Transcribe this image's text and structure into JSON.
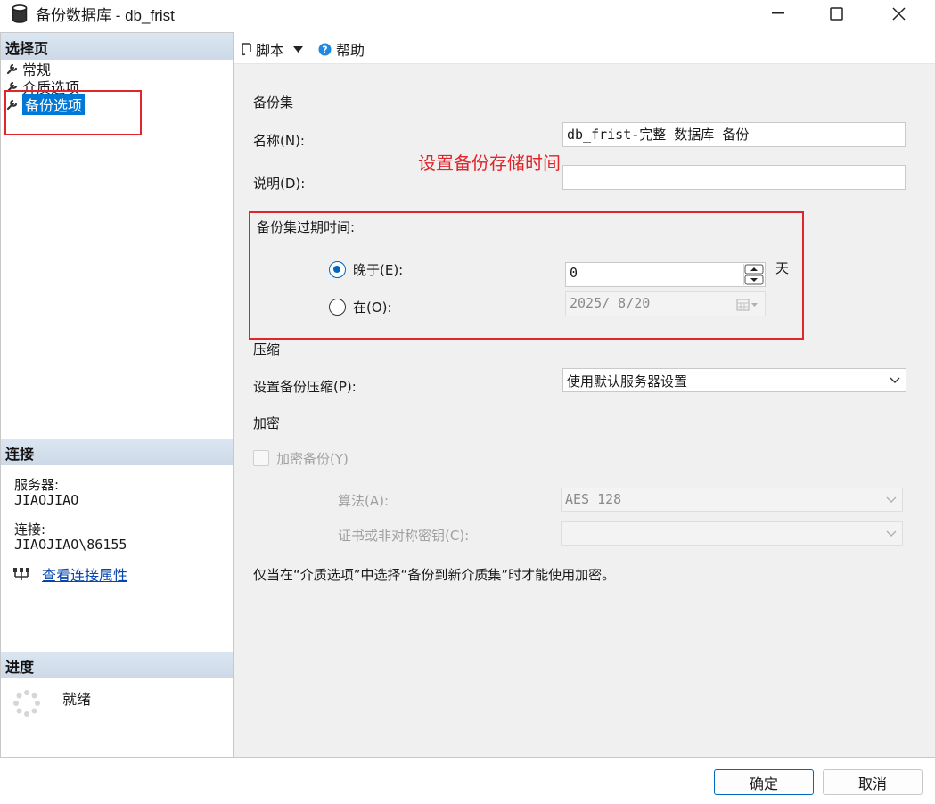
{
  "window": {
    "title": "备份数据库 - db_frist"
  },
  "left": {
    "select_page_header": "选择页",
    "nav_items": [
      {
        "label": "常规"
      },
      {
        "label": "介质选项"
      },
      {
        "label": "备份选项"
      }
    ],
    "connection": {
      "header": "连接",
      "server_label": "服务器:",
      "server_value": "JIAOJIAO",
      "conn_label": "连接:",
      "conn_value": "JIAOJIAO\\86155",
      "view_props_link": "查看连接属性"
    },
    "progress": {
      "header": "进度",
      "status": "就绪"
    }
  },
  "toolbar": {
    "script_label": "脚本",
    "help_label": "帮助"
  },
  "backup_set": {
    "group_label": "备份集",
    "name_label": "名称(N):",
    "name_value": "db_frist-完整 数据库 备份",
    "desc_label": "说明(D):",
    "desc_value": "",
    "expire_label": "备份集过期时间:",
    "after_label": "晚于(E):",
    "after_value": "0",
    "after_unit": "天",
    "on_label": "在(O):",
    "on_value": "2025/ 8/20"
  },
  "compression": {
    "group_label": "压缩",
    "setting_label": "设置备份压缩(P):",
    "setting_value": "使用默认服务器设置"
  },
  "encryption": {
    "group_label": "加密",
    "encrypt_checkbox_label": "加密备份(Y)",
    "algorithm_label": "算法(A):",
    "algorithm_value": "AES 128",
    "cert_label": "证书或非对称密钥(C):",
    "cert_value": "",
    "note": "仅当在“介质选项”中选择“备份到新介质集”时才能使用加密。"
  },
  "annotation": {
    "text": "设置备份存储时间"
  },
  "footer": {
    "ok_label": "确定",
    "cancel_label": "取消"
  },
  "colors": {
    "accent": "#0067c0",
    "selection": "#0078d7",
    "annotation_red": "#e0262b"
  }
}
